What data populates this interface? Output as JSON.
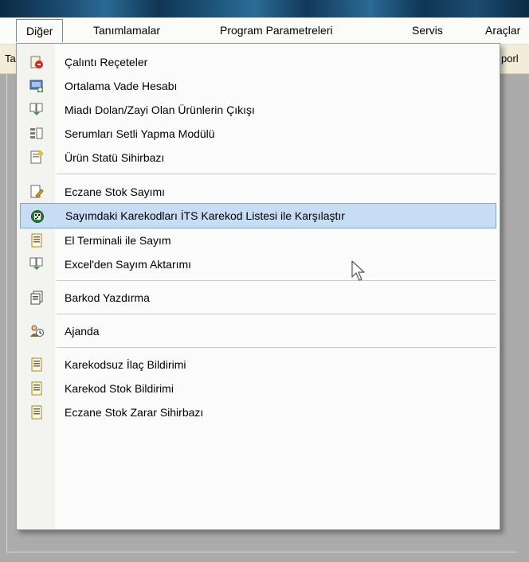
{
  "menubar": {
    "items": [
      {
        "label": "Diğer"
      },
      {
        "label": "Tanımlamalar"
      },
      {
        "label": "Program Parametreleri"
      },
      {
        "label": "Servis"
      },
      {
        "label": "Araçlar"
      }
    ]
  },
  "toolbar": {
    "left_text": "Ta",
    "right_text": "porl"
  },
  "dropdown": {
    "items": [
      {
        "label": "Çalıntı Reçeteler",
        "icon": "stolen-prescription-icon"
      },
      {
        "label": "Ortalama Vade Hesabı",
        "icon": "average-term-calc-icon"
      },
      {
        "label": "Miadı Dolan/Zayi Olan Ürünlerin Çıkışı",
        "icon": "expired-products-icon"
      },
      {
        "label": "Serumları Setli Yapma Modülü",
        "icon": "serum-set-icon"
      },
      {
        "label": "Ürün Statü Sihirbazı",
        "icon": "product-status-wizard-icon"
      },
      {
        "label": "Eczane Stok Sayımı",
        "icon": "stock-count-icon"
      },
      {
        "label": "Sayımdaki Karekodları İTS Karekod Listesi ile Karşılaştır",
        "icon": "compare-datamatrix-icon"
      },
      {
        "label": "El Terminali ile Sayım",
        "icon": "handheld-count-icon"
      },
      {
        "label": "Excel'den Sayım Aktarımı",
        "icon": "excel-import-icon"
      },
      {
        "label": "Barkod Yazdırma",
        "icon": "barcode-print-icon"
      },
      {
        "label": "Ajanda",
        "icon": "agenda-icon"
      },
      {
        "label": "Karekodsuz İlaç Bildirimi",
        "icon": "document-icon"
      },
      {
        "label": "Karekod Stok Bildirimi",
        "icon": "document-icon"
      },
      {
        "label": "Eczane Stok Zarar Sihirbazı",
        "icon": "document-icon"
      }
    ],
    "highlighted_index": 6
  },
  "colors": {
    "highlight_bg": "#c6ddf4",
    "highlight_border": "#7ea7d3",
    "workspace_bg": "#ababab",
    "toolbar_bg": "#f2ecd9"
  }
}
